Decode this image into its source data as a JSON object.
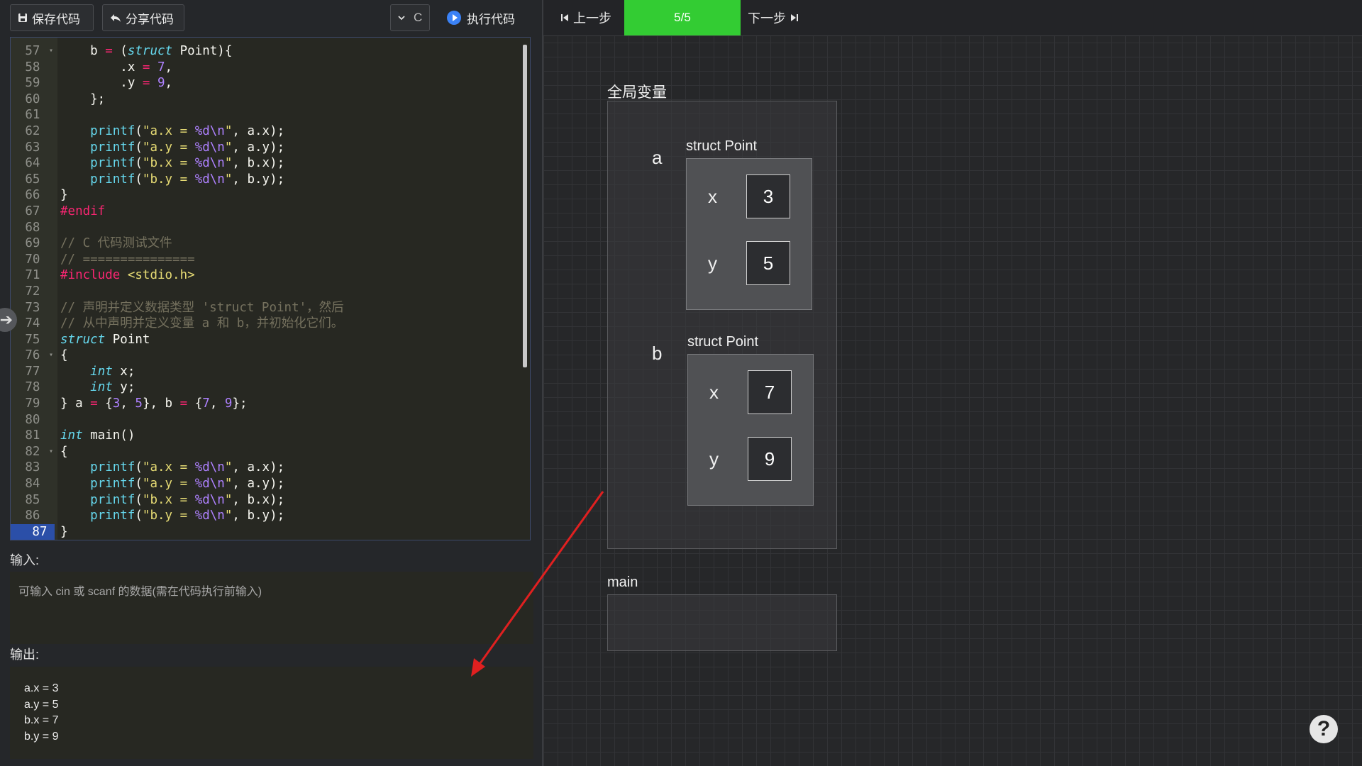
{
  "toolbar": {
    "save_label": "保存代码",
    "share_label": "分享代码",
    "language": "C",
    "run_label": "执行代码"
  },
  "nav": {
    "prev_label": "上一步",
    "step": "5/5",
    "next_label": "下一步"
  },
  "editor": {
    "active_line": 87,
    "lines": [
      {
        "n": 57,
        "fold": true,
        "text": "    b = (struct Point){"
      },
      {
        "n": 58,
        "text": "        .x = 7,"
      },
      {
        "n": 59,
        "text": "        .y = 9,"
      },
      {
        "n": 60,
        "text": "    };"
      },
      {
        "n": 61,
        "text": ""
      },
      {
        "n": 62,
        "text": "    printf(\"a.x = %d\\n\", a.x);"
      },
      {
        "n": 63,
        "text": "    printf(\"a.y = %d\\n\", a.y);"
      },
      {
        "n": 64,
        "text": "    printf(\"b.x = %d\\n\", b.x);"
      },
      {
        "n": 65,
        "text": "    printf(\"b.y = %d\\n\", b.y);"
      },
      {
        "n": 66,
        "text": "}"
      },
      {
        "n": 67,
        "text": "#endif"
      },
      {
        "n": 68,
        "text": ""
      },
      {
        "n": 69,
        "text": "// C 代码测试文件"
      },
      {
        "n": 70,
        "text": "// ==============="
      },
      {
        "n": 71,
        "text": "#include <stdio.h>"
      },
      {
        "n": 72,
        "text": ""
      },
      {
        "n": 73,
        "text": "// 声明并定义数据类型 'struct Point'，然后"
      },
      {
        "n": 74,
        "text": "// 从中声明并定义变量 a 和 b，并初始化它们。"
      },
      {
        "n": 75,
        "text": "struct Point"
      },
      {
        "n": 76,
        "fold": true,
        "text": "{"
      },
      {
        "n": 77,
        "text": "    int x;"
      },
      {
        "n": 78,
        "text": "    int y;"
      },
      {
        "n": 79,
        "text": "} a = {3, 5}, b = {7, 9};"
      },
      {
        "n": 80,
        "text": ""
      },
      {
        "n": 81,
        "text": "int main()"
      },
      {
        "n": 82,
        "fold": true,
        "text": "{"
      },
      {
        "n": 83,
        "text": "    printf(\"a.x = %d\\n\", a.x);"
      },
      {
        "n": 84,
        "text": "    printf(\"a.y = %d\\n\", a.y);"
      },
      {
        "n": 85,
        "text": "    printf(\"b.x = %d\\n\", b.x);"
      },
      {
        "n": 86,
        "text": "    printf(\"b.y = %d\\n\", b.y);"
      },
      {
        "n": 87,
        "text": "}"
      }
    ]
  },
  "input": {
    "label": "输入:",
    "placeholder": "可输入 cin 或 scanf 的数据(需在代码执行前输入)"
  },
  "output": {
    "label": "输出:",
    "lines": [
      "a.x = 3",
      "a.y = 5",
      "b.x = 7",
      "b.y = 9"
    ]
  },
  "visualizer": {
    "globals_title": "全局变量",
    "main_title": "main",
    "vars": [
      {
        "name": "a",
        "type": "struct Point",
        "fields": [
          {
            "name": "x",
            "value": "3"
          },
          {
            "name": "y",
            "value": "5"
          }
        ]
      },
      {
        "name": "b",
        "type": "struct Point",
        "fields": [
          {
            "name": "x",
            "value": "7"
          },
          {
            "name": "y",
            "value": "9"
          }
        ]
      }
    ]
  },
  "help_label": "?",
  "colors": {
    "step_counter": "#33cc33",
    "annotation_arrow": "#e02020",
    "active_line": "#2b4fa8",
    "run_icon": "#3b82f6"
  }
}
